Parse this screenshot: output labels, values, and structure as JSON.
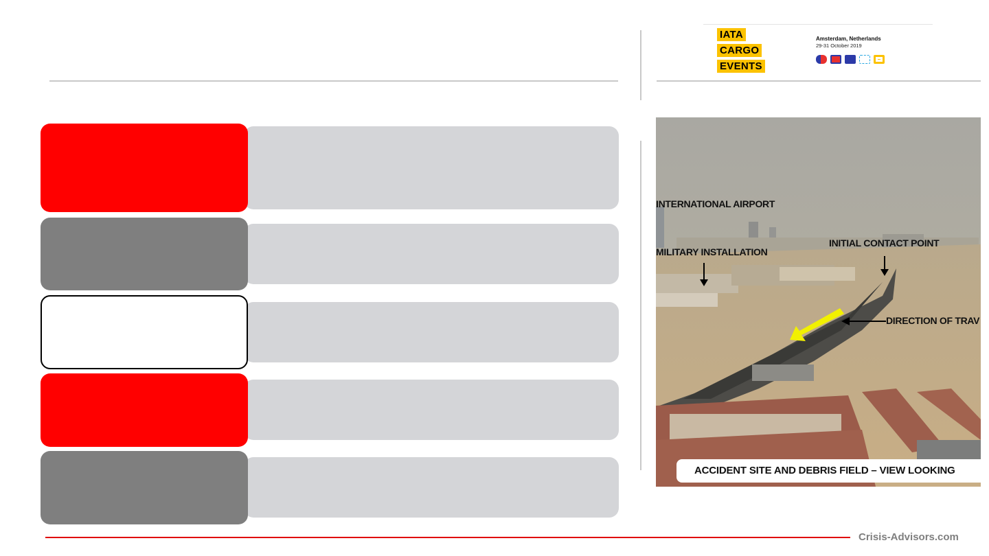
{
  "logo": {
    "words": [
      "IATA",
      "CARGO",
      "EVENTS"
    ],
    "city": "Amsterdam, Netherlands",
    "dates": "29-31 October 2019",
    "icon_names": [
      "pill-icon",
      "first-aid-icon",
      "cube-icon",
      "dashed-box-icon",
      "screen-icon"
    ]
  },
  "photo": {
    "labels": {
      "airport": "INTERNATIONAL AIRPORT",
      "military": "MILITARY INSTALLATION",
      "contact": "INITIAL CONTACT POINT",
      "direction": "DIRECTION OF TRAV"
    },
    "caption": "ACCIDENT SITE AND DEBRIS FIELD – VIEW LOOKING"
  },
  "colors": {
    "accent_red": "#ff0000",
    "tab_gray": "#7f7f7f",
    "bar_gray": "#d4d5d8",
    "logo_yellow": "#fcc200"
  },
  "footer": {
    "brand": "Crisis-Advisors.com"
  }
}
